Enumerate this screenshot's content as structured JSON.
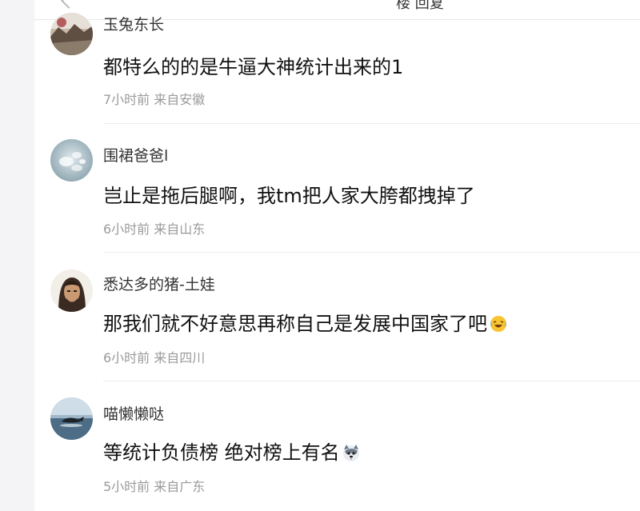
{
  "header": {
    "back_label": "back",
    "top_text": "楼 回复"
  },
  "comments": [
    {
      "username": "玉兔东长",
      "content": "都特么的的是牛逼大神统计出来的1",
      "time": "7小时前",
      "location": "来自安徽",
      "avatar": "landscape-photo"
    },
    {
      "username": "围裙爸爸l",
      "content": "岂止是拖后腿啊，我tm把人家大胯都拽掉了",
      "time": "6小时前",
      "location": "来自山东",
      "avatar": "water-drops"
    },
    {
      "username": "悉达多的猪-土娃",
      "content": "那我们就不好意思再称自己是发展中国家了吧",
      "emoji": "laughing-crying-emoji",
      "time": "6小时前",
      "location": "来自四川",
      "avatar": "portrait-man"
    },
    {
      "username": "喵懒懒哒",
      "content": "等统计负债榜 绝对榜上有名",
      "emoji": "husky-dog-emoji",
      "time": "5小时前",
      "location": "来自广东",
      "avatar": "sea-bird"
    }
  ]
}
